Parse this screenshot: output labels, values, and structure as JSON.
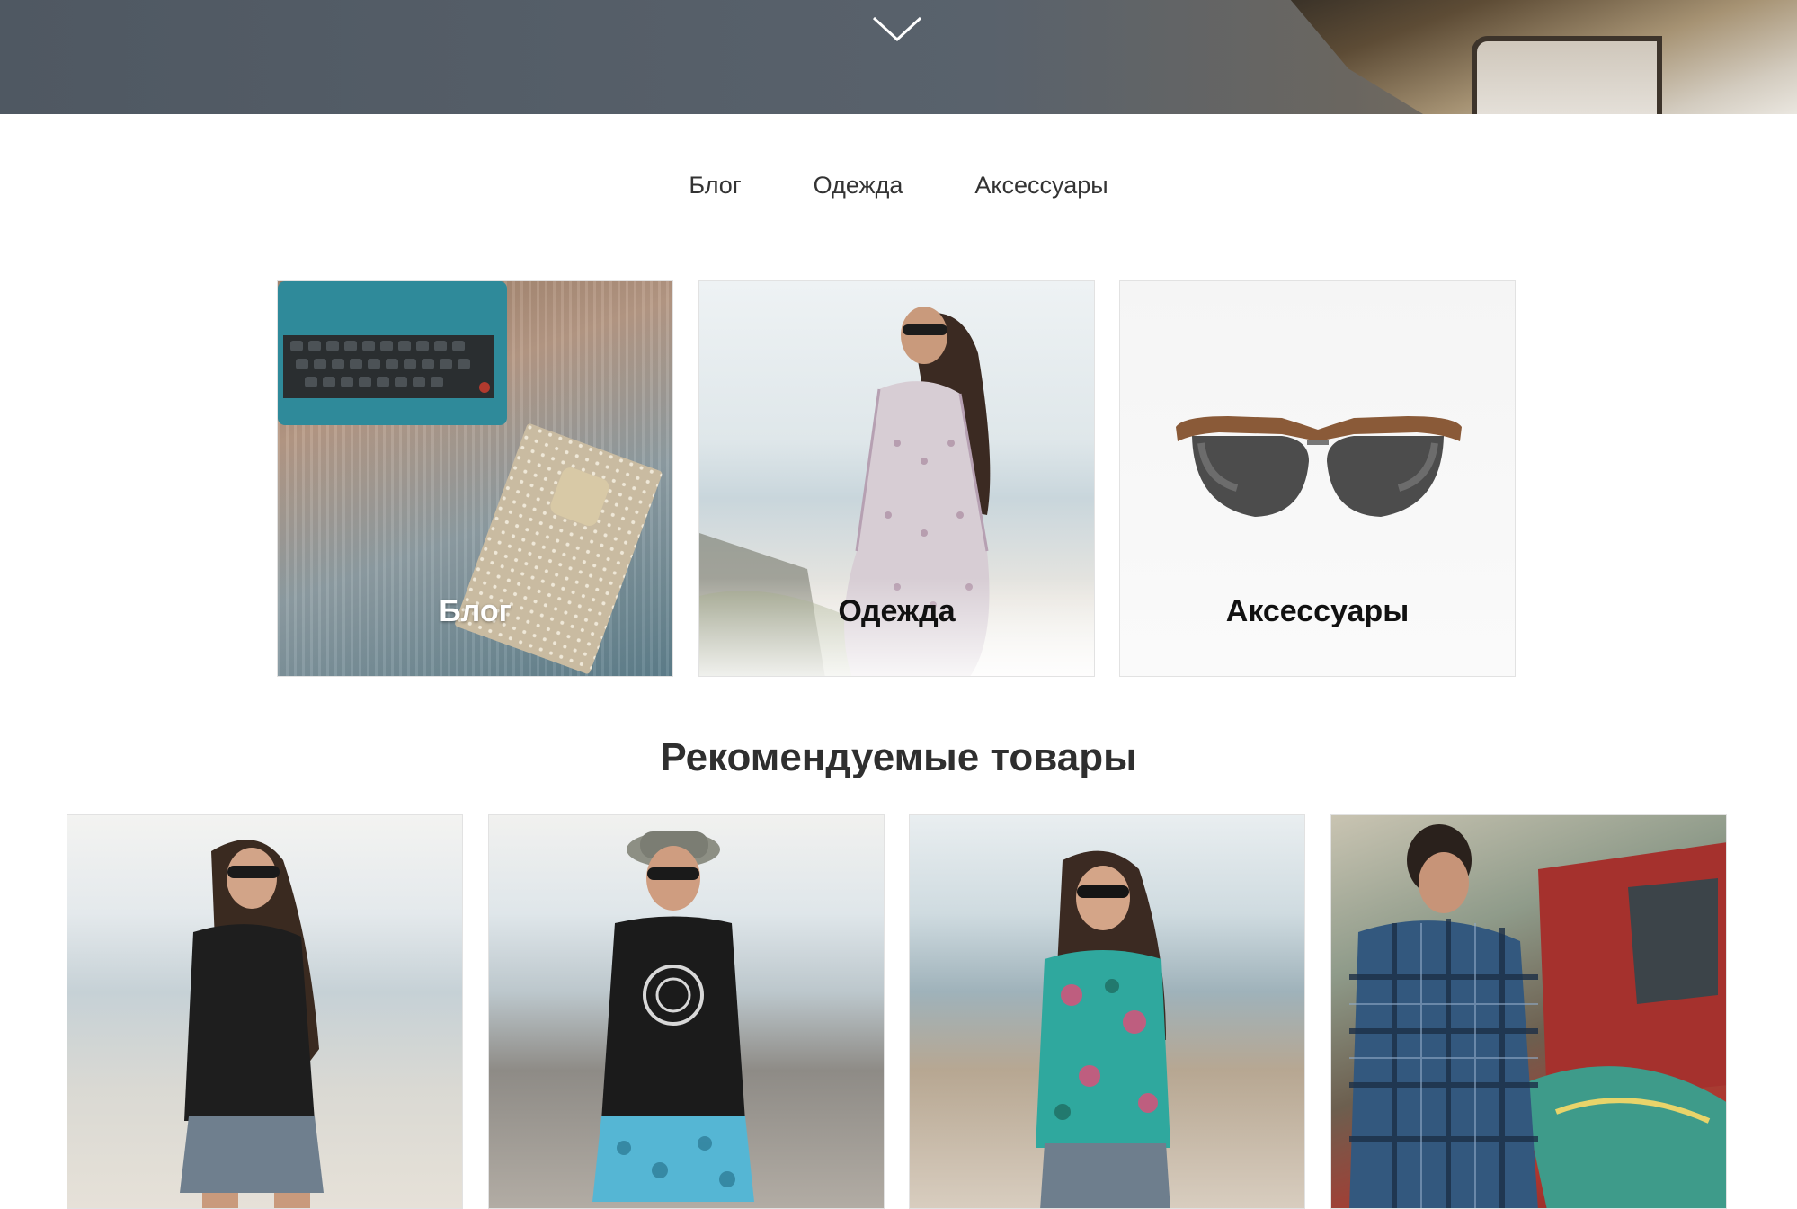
{
  "nav": {
    "items": [
      {
        "label": "Блог"
      },
      {
        "label": "Одежда"
      },
      {
        "label": "Аксессуары"
      }
    ]
  },
  "categories": [
    {
      "label": "Блог"
    },
    {
      "label": "Одежда"
    },
    {
      "label": "Аксессуары"
    }
  ],
  "featured": {
    "title": "Рекомендуемые товары"
  },
  "icons": {
    "scroll_down": "chevron-down-icon"
  },
  "colors": {
    "hero_bg": "#56606a",
    "text": "#333333",
    "card_border": "#e2e2e2"
  }
}
